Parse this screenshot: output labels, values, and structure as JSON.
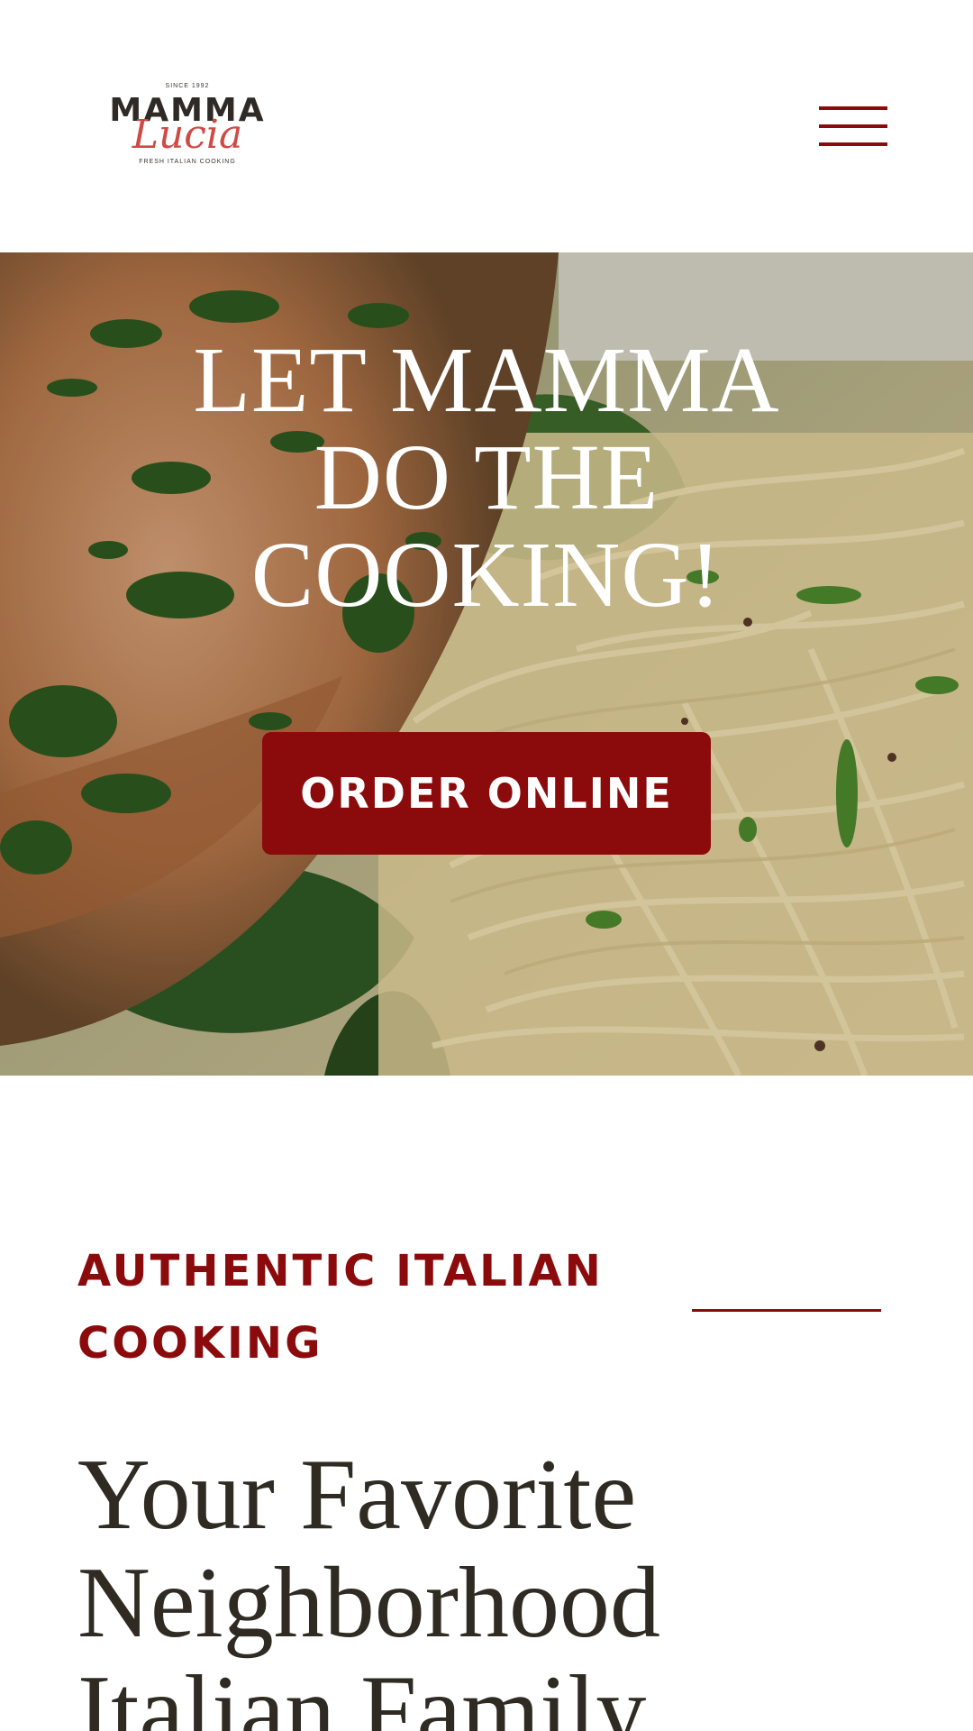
{
  "header": {
    "logo": {
      "since": "SINCE 1992",
      "line1": "MAMMA",
      "line2": "Lucia",
      "tagline": "FRESH ITALIAN COOKING"
    },
    "menu_icon": "hamburger-menu-icon"
  },
  "hero": {
    "title": "LET MAMMA DO THE COOKING!",
    "cta_label": "ORDER ONLINE"
  },
  "intro": {
    "eyebrow": "AUTHENTIC ITALIAN COOKING",
    "headline": "Your Favorite Neighborhood Italian Family"
  },
  "colors": {
    "brand_red": "#8b0b0d",
    "logo_red": "#d04a45",
    "text_dark": "#2f2a22",
    "background": "#ffffff"
  }
}
